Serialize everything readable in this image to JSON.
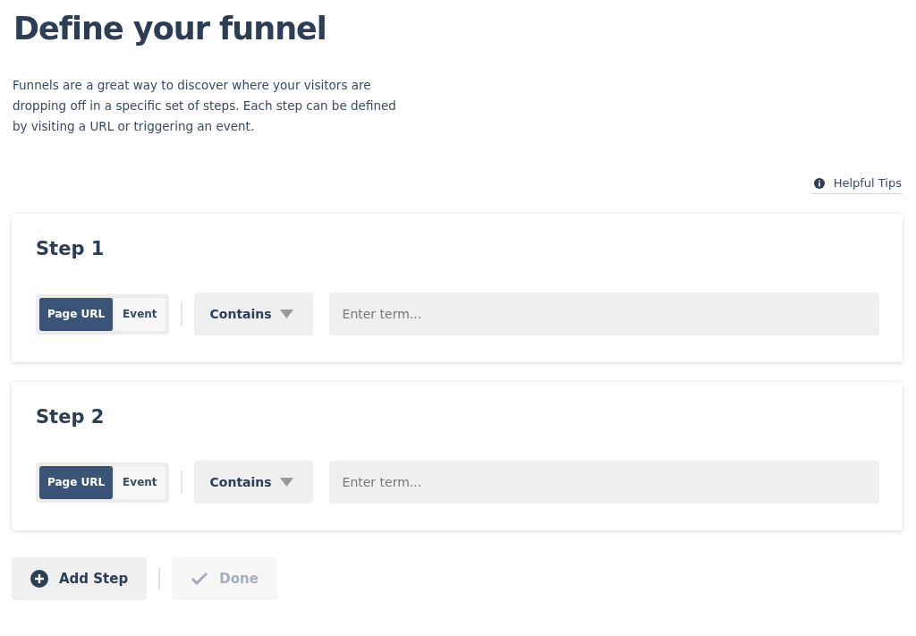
{
  "title": "Define your funnel",
  "description": "Funnels are a great way to discover where your visitors are dropping off in a specific set of steps. Each step can be defined by visiting a URL or triggering an event.",
  "helpful_tips": "Helpful Tips",
  "steps": [
    {
      "title": "Step 1",
      "types": [
        {
          "label": "Page URL",
          "selected": true
        },
        {
          "label": "Event",
          "selected": false
        }
      ],
      "match": "Contains",
      "placeholder": "Enter term..."
    },
    {
      "title": "Step 2",
      "types": [
        {
          "label": "Page URL",
          "selected": true
        },
        {
          "label": "Event",
          "selected": false
        }
      ],
      "match": "Contains",
      "placeholder": "Enter term..."
    }
  ],
  "add_step": {
    "label": "Add Step",
    "disabled": false
  },
  "done": {
    "label": "Done",
    "disabled": true
  }
}
